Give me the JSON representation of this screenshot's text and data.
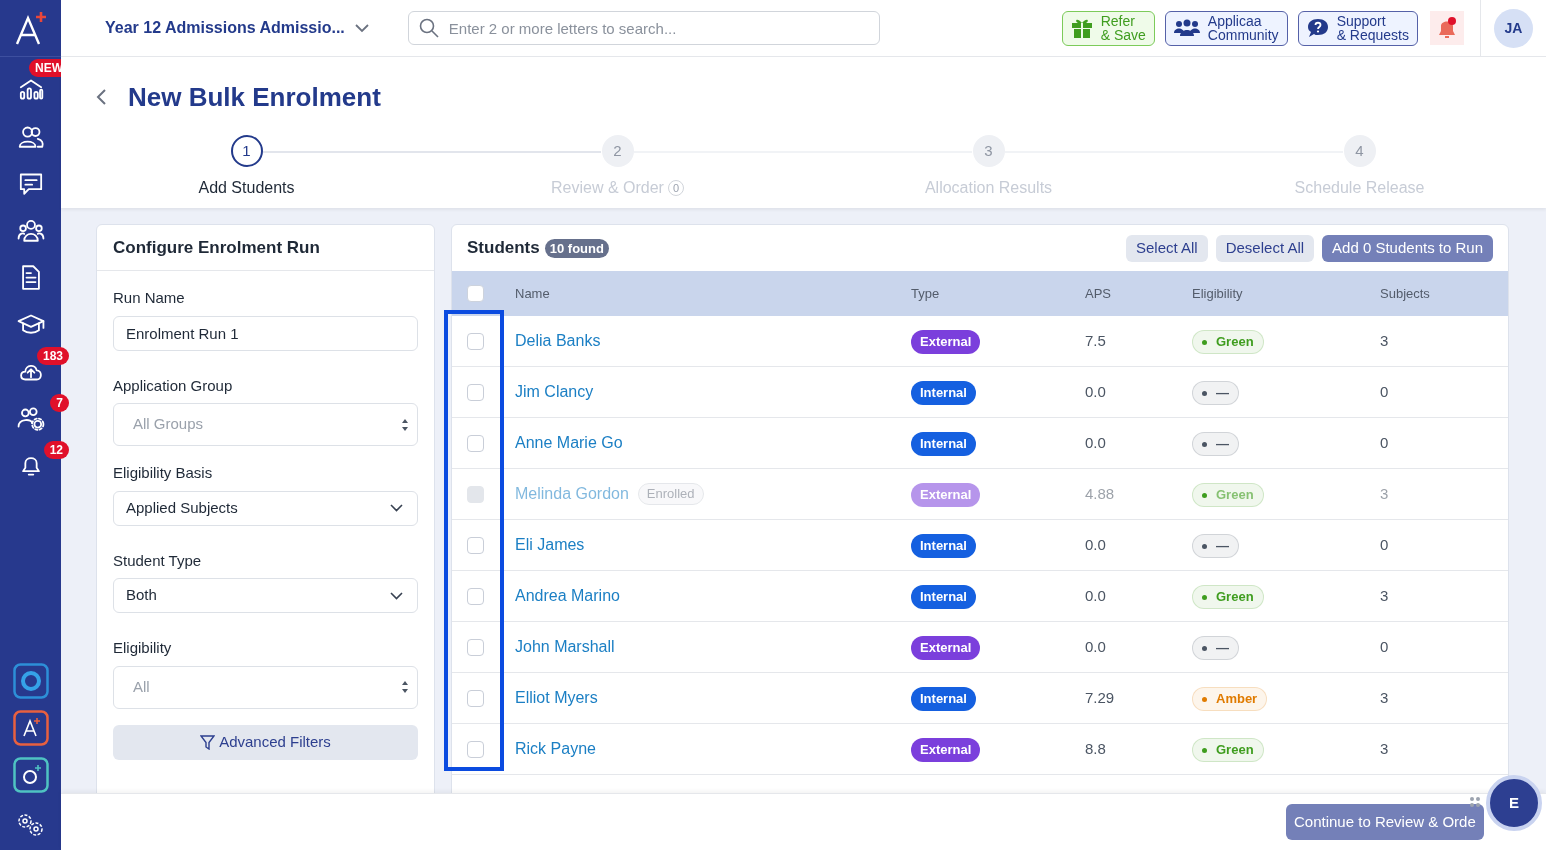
{
  "sidebar": {
    "items": [
      {
        "kind": "dashboard",
        "badge": "NEW"
      },
      {
        "kind": "contacts"
      },
      {
        "kind": "messages"
      },
      {
        "kind": "groups"
      },
      {
        "kind": "documents"
      },
      {
        "kind": "courses"
      },
      {
        "kind": "uploads",
        "badge": "183"
      },
      {
        "kind": "staff",
        "badge": "7"
      },
      {
        "kind": "alerts",
        "badge": "12"
      }
    ]
  },
  "topbar": {
    "program": "Year 12 Admissions Admissio...",
    "search": {
      "placeholder": "Enter 2 or more letters to search..."
    },
    "buttons": [
      {
        "kind": "refer",
        "label": [
          "Refer",
          "& Save"
        ]
      },
      {
        "kind": "community",
        "label": [
          "Applicaa",
          "Community"
        ]
      },
      {
        "kind": "support",
        "label": [
          "Support",
          "& Requests"
        ]
      }
    ],
    "notifications": {
      "unread": true
    },
    "avatar": "JA"
  },
  "page": {
    "title": "New Bulk Enrolment"
  },
  "steps": [
    {
      "number": "1",
      "label": "Add Students",
      "selected": true
    },
    {
      "number": "2",
      "label": "Review & Order",
      "selected": false,
      "count": "0"
    },
    {
      "number": "3",
      "label": "Allocation Results",
      "selected": false
    },
    {
      "number": "4",
      "label": "Schedule Release",
      "selected": false
    }
  ],
  "config": {
    "title": "Configure Enrolment Run",
    "fields": [
      {
        "kind": "text",
        "label": "Run Name",
        "value": "Enrolment Run 1"
      },
      {
        "kind": "native",
        "label": "Application Group",
        "placeholder": "All Groups"
      },
      {
        "kind": "select",
        "label": "Eligibility Basis",
        "value": "Applied Subjects"
      },
      {
        "kind": "select",
        "label": "Student Type",
        "value": "Both"
      },
      {
        "kind": "native",
        "label": "Eligibility",
        "placeholder": "All"
      }
    ],
    "advanced": "Advanced Filters"
  },
  "students": {
    "title": "Students",
    "count": "10 found",
    "actions": [
      "Select All",
      "Deselect All",
      "Add 0 Students to Run"
    ],
    "columns": [
      "Name",
      "Type",
      "APS",
      "Eligibility",
      "Subjects"
    ],
    "all_checked": false,
    "rows": [
      {
        "name": "Delia Banks",
        "tag": null,
        "disabled": false,
        "checked": false,
        "type": "External",
        "kind": "external",
        "aps": "7.5",
        "eligibility": {
          "label": "Green",
          "color": "#3f9d1f"
        },
        "subjects": "3"
      },
      {
        "name": "Jim Clancy",
        "tag": null,
        "disabled": false,
        "checked": false,
        "type": "Internal",
        "kind": "internal",
        "aps": "0.0",
        "eligibility": {
          "label": "—",
          "color": "#4b5563"
        },
        "subjects": "0"
      },
      {
        "name": "Anne Marie Go",
        "tag": null,
        "disabled": false,
        "checked": false,
        "type": "Internal",
        "kind": "internal",
        "aps": "0.0",
        "eligibility": {
          "label": "—",
          "color": "#4b5563"
        },
        "subjects": "0"
      },
      {
        "name": "Melinda Gordon",
        "tag": "Enrolled",
        "disabled": true,
        "checked": false,
        "type": "External",
        "kind": "external",
        "aps": "4.88",
        "eligibility": {
          "label": "Green",
          "color": "#3f9d1f"
        },
        "subjects": "3"
      },
      {
        "name": "Eli James",
        "tag": null,
        "disabled": false,
        "checked": false,
        "type": "Internal",
        "kind": "internal",
        "aps": "0.0",
        "eligibility": {
          "label": "—",
          "color": "#4b5563"
        },
        "subjects": "0"
      },
      {
        "name": "Andrea Marino",
        "tag": null,
        "disabled": false,
        "checked": false,
        "type": "Internal",
        "kind": "internal",
        "aps": "0.0",
        "eligibility": {
          "label": "Green",
          "color": "#3f9d1f"
        },
        "subjects": "3"
      },
      {
        "name": "John Marshall",
        "tag": null,
        "disabled": false,
        "checked": false,
        "type": "External",
        "kind": "external",
        "aps": "0.0",
        "eligibility": {
          "label": "—",
          "color": "#4b5563"
        },
        "subjects": "0"
      },
      {
        "name": "Elliot Myers",
        "tag": null,
        "disabled": false,
        "checked": false,
        "type": "Internal",
        "kind": "internal",
        "aps": "7.29",
        "eligibility": {
          "label": "Amber",
          "color": "#e07b00"
        },
        "subjects": "3"
      },
      {
        "name": "Rick Payne",
        "tag": null,
        "disabled": false,
        "checked": false,
        "type": "External",
        "kind": "external",
        "aps": "8.8",
        "eligibility": {
          "label": "Green",
          "color": "#3f9d1f"
        },
        "subjects": "3"
      }
    ]
  },
  "footer": {
    "continue": "Continue to Review & Orde",
    "assistant": "E"
  }
}
